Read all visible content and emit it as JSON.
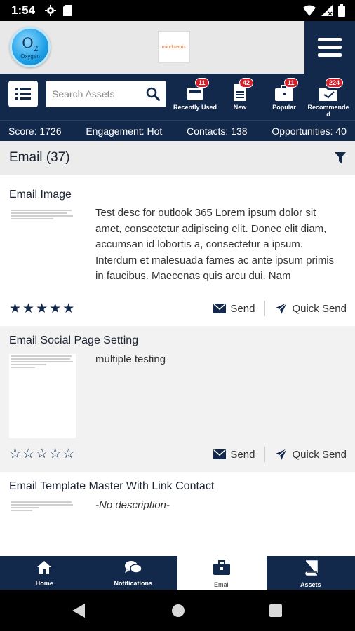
{
  "status_bar": {
    "time": "1:54"
  },
  "header": {
    "logo_text": "O",
    "logo_sub": "2",
    "logo_caption": "Oxygen",
    "brand_text": "mindmatrix"
  },
  "search": {
    "placeholder": "Search Assets"
  },
  "quick_access": [
    {
      "label": "Recently Used",
      "badge": "11",
      "icon": "tray-icon"
    },
    {
      "label": "New",
      "badge": "42",
      "icon": "document-icon"
    },
    {
      "label": "Popular",
      "badge": "11",
      "icon": "briefcase-icon"
    },
    {
      "label": "Recommende\nd",
      "badge": "224",
      "icon": "folder-icon"
    }
  ],
  "stats": {
    "score": "Score: 1726",
    "engagement": "Engagement: Hot",
    "contacts": "Contacts: 138",
    "opportunities": "Opportunities: 40"
  },
  "section": {
    "title": "Email (37)"
  },
  "cards": [
    {
      "title": "Email Image",
      "description": "Test desc for outlook 365 Lorem ipsum dolor sit amet, consectetur adipiscing elit. Donec elit diam, accumsan id lobortis a, consectetur a ipsum. Interdum et malesuada fames ac ante ipsum primis in faucibus. Maecenas quis arcu dui. Nam",
      "rating": 5,
      "send_label": "Send",
      "quick_send_label": "Quick Send"
    },
    {
      "title": "Email Social Page Setting",
      "description": "multiple testing",
      "rating": 0,
      "send_label": "Send",
      "quick_send_label": "Quick Send"
    },
    {
      "title": "Email Template Master With Link Contact",
      "description": "-No description-"
    }
  ],
  "bottom_nav": [
    {
      "label": "Home",
      "icon": "home-icon",
      "active": false
    },
    {
      "label": "Notifications",
      "icon": "chat-bubbles-icon",
      "active": false
    },
    {
      "label": "Email",
      "icon": "briefcase-icon",
      "active": true
    },
    {
      "label": "Assets",
      "icon": "book-icon",
      "active": false
    }
  ],
  "colors": {
    "primary": "#13294b",
    "badge": "#d61f2c",
    "background": "#f2f2f2"
  }
}
